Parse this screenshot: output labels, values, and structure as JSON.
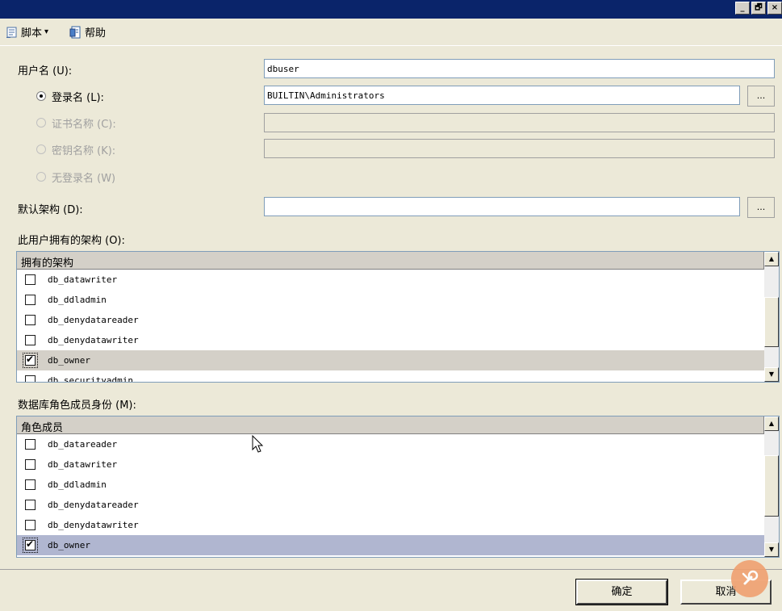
{
  "titlebar": {
    "min": "_",
    "restore": "🗗",
    "close": "×"
  },
  "toolbar": {
    "script_label": "脚本",
    "dropdown_glyph": "▾",
    "help_label": "帮助"
  },
  "form": {
    "username_label": "用户名 (U):",
    "username_value": "dbuser",
    "login_radio_label": "登录名 (L):",
    "login_value": "BUILTIN\\Administrators",
    "cert_radio_label": "证书名称 (C):",
    "key_radio_label": "密钥名称 (K):",
    "nologin_radio_label": "无登录名 (W)",
    "default_schema_label": "默认架构 (D):",
    "default_schema_value": "",
    "browse_label": "..."
  },
  "owned_schemas": {
    "section_label": "此用户拥有的架构 (O):",
    "header": "拥有的架构",
    "items": [
      {
        "name": "db_datawriter",
        "checked": false
      },
      {
        "name": "db_ddladmin",
        "checked": false
      },
      {
        "name": "db_denydatareader",
        "checked": false
      },
      {
        "name": "db_denydatawriter",
        "checked": false
      },
      {
        "name": "db_owner",
        "checked": true
      },
      {
        "name": "db_securityadmin",
        "checked": false
      }
    ]
  },
  "role_members": {
    "section_label": "数据库角色成员身份 (M):",
    "header": "角色成员",
    "items": [
      {
        "name": "db_datareader",
        "checked": false
      },
      {
        "name": "db_datawriter",
        "checked": false
      },
      {
        "name": "db_ddladmin",
        "checked": false
      },
      {
        "name": "db_denydatareader",
        "checked": false
      },
      {
        "name": "db_denydatawriter",
        "checked": false
      },
      {
        "name": "db_owner",
        "checked": true
      }
    ]
  },
  "scroll": {
    "up": "▲",
    "down": "▼"
  },
  "buttons": {
    "ok": "确定",
    "cancel": "取消"
  },
  "check_glyph": "✔",
  "colors": {
    "titlebar": "#0a246a",
    "selected_row": "#b0b6d0",
    "help_badge": "#f0a070"
  }
}
